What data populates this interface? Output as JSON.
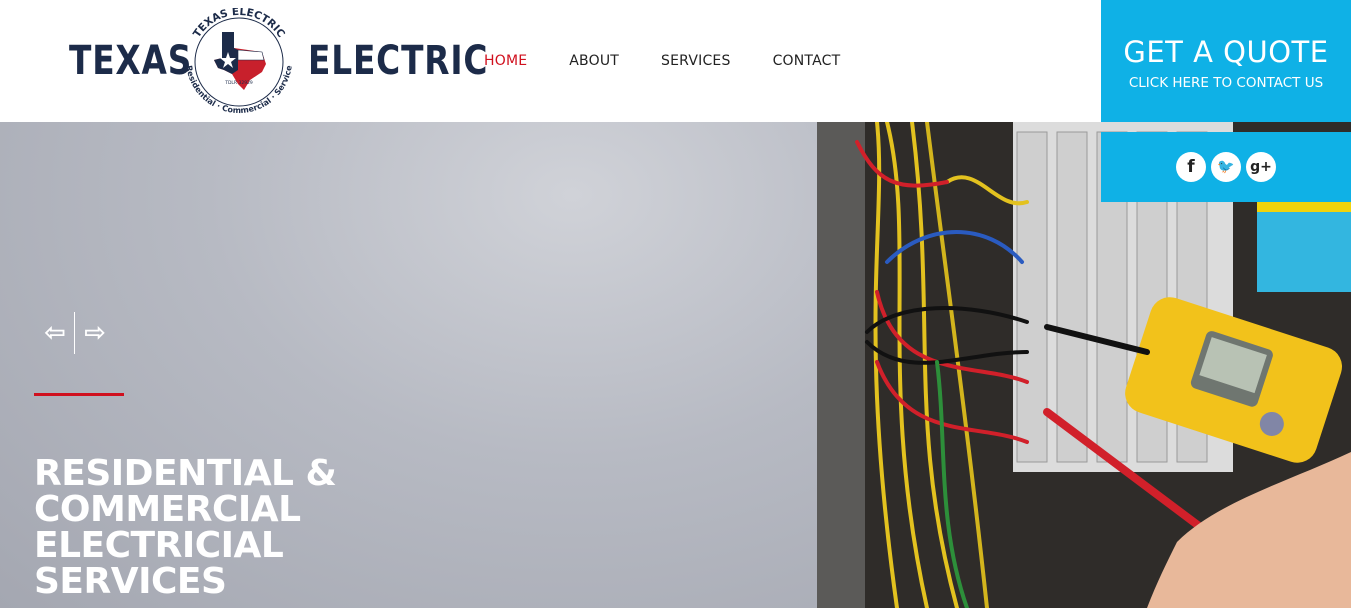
{
  "brand": {
    "left_word": "TEXAS",
    "right_word": "ELECTRIC",
    "seal_top_text": "TEXAS ELECTRIC",
    "seal_bottom_text": "Residential · Commercial · Service",
    "seal_license": "TDLR 32929",
    "colors": {
      "navy": "#1c2b49",
      "red": "#c8202c"
    }
  },
  "nav": {
    "items": [
      {
        "label": "HOME",
        "active": true
      },
      {
        "label": "ABOUT",
        "active": false
      },
      {
        "label": "SERVICES",
        "active": false
      },
      {
        "label": "CONTACT",
        "active": false
      }
    ],
    "active_color": "#d0101e"
  },
  "quote": {
    "title": "GET A QUOTE",
    "subtitle": "CLICK HERE TO CONTACT US",
    "background": "#0fb1e6"
  },
  "social": [
    {
      "icon": "facebook-icon",
      "glyph": "f"
    },
    {
      "icon": "twitter-icon",
      "glyph": "🐦"
    },
    {
      "icon": "google-plus-icon",
      "glyph": "g+"
    }
  ],
  "slider": {
    "prev_glyph": "⇦",
    "next_glyph": "⇨"
  },
  "hero": {
    "title_lines": [
      "RESIDENTIAL &",
      "COMMERCIAL",
      "ELECTRICIAL",
      "SERVICES"
    ]
  }
}
